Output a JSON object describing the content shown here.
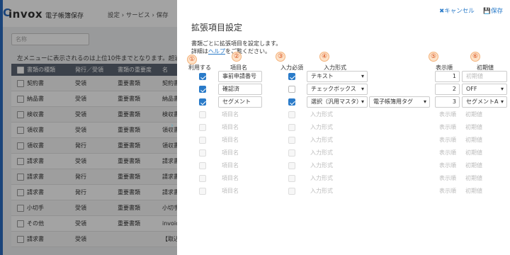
{
  "app": {
    "logo_c": "C",
    "logo": "invox",
    "logo_sub": "電子帳簿保存",
    "breadcrumb": "設定 › サービス › 保存"
  },
  "background": {
    "name_placeholder": "名称",
    "notice": "左メニューに表示されるのは上位10件までとなります。超過",
    "columns": [
      "書類の種類",
      "発行／受領",
      "書類の重要度",
      "名"
    ],
    "rows": [
      [
        "契約書",
        "受領",
        "重要書類",
        "契約書"
      ],
      [
        "納品書",
        "受領",
        "重要書類",
        "納品書"
      ],
      [
        "検収書",
        "受領",
        "重要書類",
        "検収書"
      ],
      [
        "領収書",
        "受領",
        "重要書類",
        "領収書"
      ],
      [
        "領収書",
        "発行",
        "重要書類",
        "領収書"
      ],
      [
        "請求書",
        "受領",
        "重要書類",
        "請求書"
      ],
      [
        "請求書",
        "発行",
        "重要書類",
        "請求書"
      ],
      [
        "請求書",
        "発行",
        "重要書類",
        "請求書"
      ],
      [
        "小切手",
        "受領",
        "重要書類",
        "小切手"
      ],
      [
        "その他",
        "受領",
        "重要書類",
        "invoice"
      ],
      [
        "請求書",
        "受領",
        "",
        "【取込"
      ]
    ]
  },
  "panel": {
    "cancel": "✖キャンセル",
    "save": "💾保存",
    "title": "拡張項目設定",
    "desc_line1": "書類ごとに拡張項目を設定します。",
    "desc_line2_pre": "詳細は",
    "desc_link": "ヘルプ",
    "desc_line2_post": "をご覧ください。",
    "markers": [
      "①",
      "②",
      "③",
      "④",
      "⑤",
      "⑥"
    ],
    "headers": {
      "use": "利用する",
      "name": "項目名",
      "required": "入力必須",
      "format": "入力形式",
      "order": "表示順",
      "initial": "初期値"
    },
    "placeholders": {
      "name": "項目名",
      "format": "入力形式",
      "order": "表示順",
      "initial": "初期値"
    },
    "rows": [
      {
        "use": true,
        "name": "事前申請番号",
        "required": true,
        "format": "テキスト",
        "extra": "",
        "order": "1",
        "initial": ""
      },
      {
        "use": true,
        "name": "確認済",
        "required": false,
        "format": "チェックボックス",
        "extra": "",
        "order": "2",
        "initial": "OFF"
      },
      {
        "use": true,
        "name": "セグメント",
        "required": true,
        "format": "選択（汎用マスタ）",
        "extra": "電子帳簿用タグ",
        "order": "3",
        "initial": "セグメントA"
      }
    ],
    "empty_rows": 7
  }
}
